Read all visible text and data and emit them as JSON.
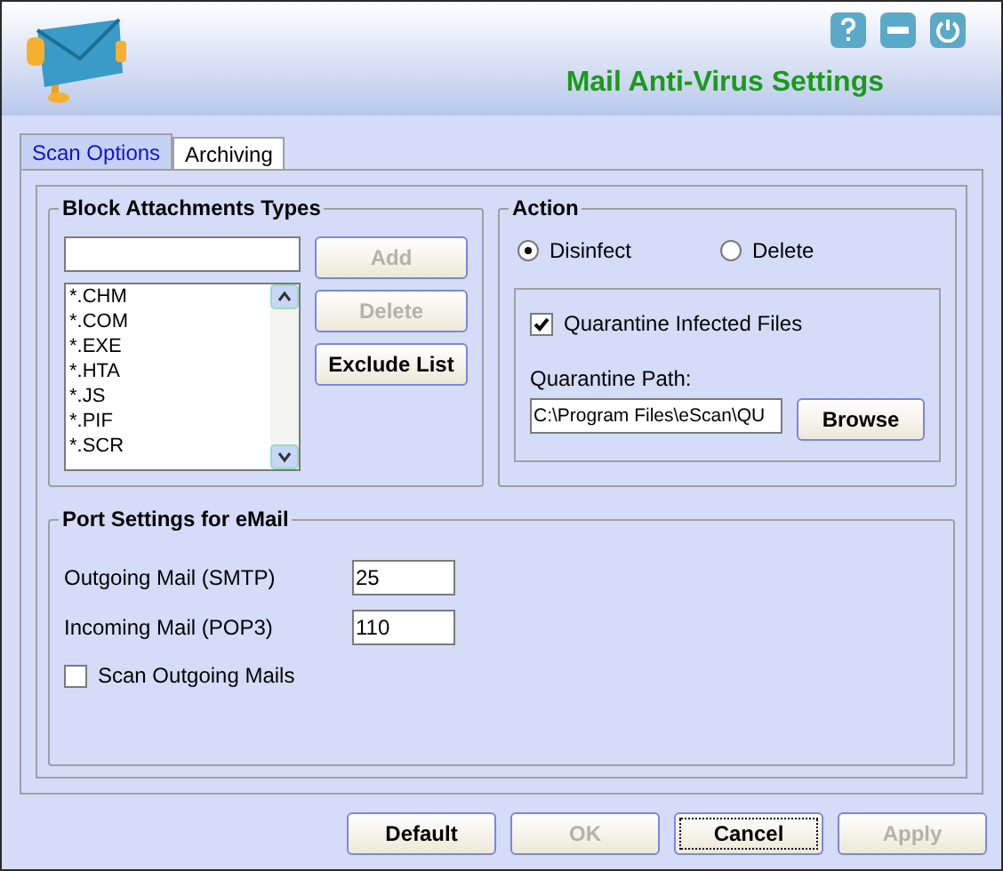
{
  "header": {
    "title": "Mail Anti-Virus Settings"
  },
  "tabs": [
    {
      "label": "Scan Options",
      "selected": true
    },
    {
      "label": "Archiving",
      "selected": false
    }
  ],
  "block_attachments": {
    "title": "Block Attachments Types",
    "buttons": [
      {
        "label": "Add",
        "disabled": true
      },
      {
        "label": "Delete",
        "disabled": true
      },
      {
        "label": "Exclude List",
        "disabled": false
      }
    ],
    "extensions": [
      "*.CHM",
      "*.COM",
      "*.EXE",
      "*.HTA",
      "*.JS",
      "*.PIF",
      "*.SCR"
    ]
  },
  "action": {
    "title": "Action",
    "options": [
      {
        "label": "Disinfect",
        "selected": true
      },
      {
        "label": "Delete",
        "selected": false
      }
    ],
    "quarantine": {
      "label": "Quarantine Infected Files",
      "checked": true
    },
    "path_label": "Quarantine Path:",
    "path_value": "C:\\Program Files\\eScan\\QU",
    "browse": "Browse"
  },
  "port_settings": {
    "title": "Port Settings for eMail",
    "fields": [
      {
        "label": "Outgoing Mail (SMTP)",
        "value": "25"
      },
      {
        "label": "Incoming Mail (POP3)",
        "value": "110"
      }
    ],
    "scan_outgoing": {
      "label": "Scan Outgoing Mails",
      "checked": false
    }
  },
  "footer_buttons": [
    {
      "label": "Default",
      "disabled": false,
      "focused": false
    },
    {
      "label": "OK",
      "disabled": true,
      "focused": false
    },
    {
      "label": "Cancel",
      "disabled": false,
      "focused": true
    },
    {
      "label": "Apply",
      "disabled": true,
      "focused": false
    }
  ]
}
